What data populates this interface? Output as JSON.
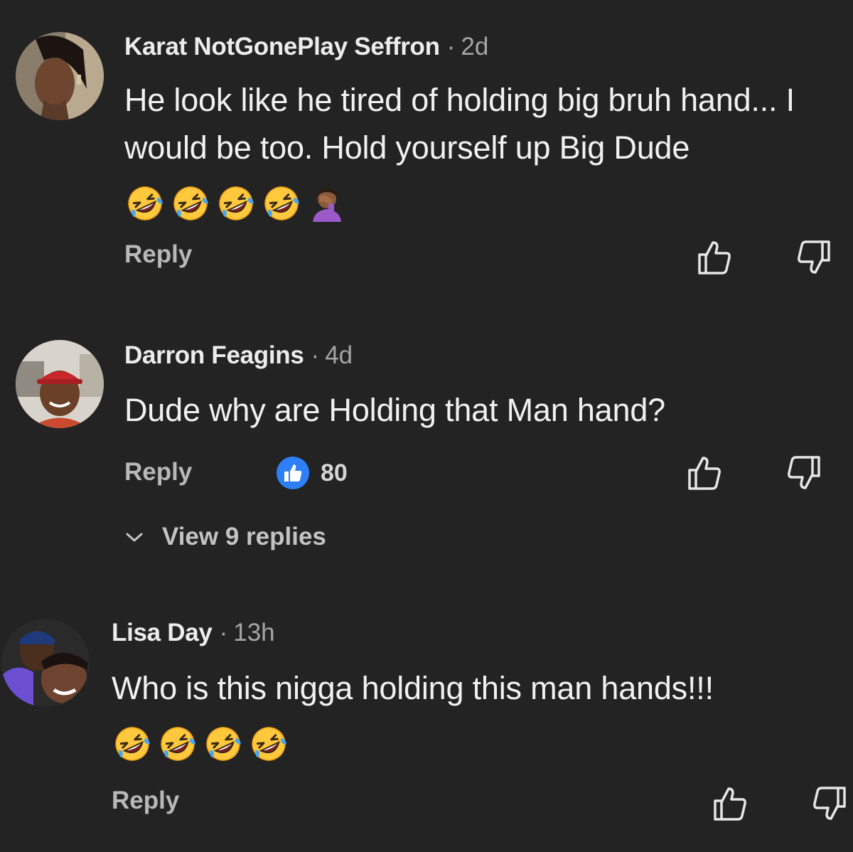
{
  "colors": {
    "background": "#232323",
    "text_primary": "#f1f1f1",
    "text_secondary": "#a5a5a5",
    "like_badge": "#2e7ff7"
  },
  "comments": [
    {
      "author": "Karat NotGonePlay Seffron",
      "separator": "·",
      "age": "2d",
      "text": "He look like he tired of holding big bruh hand... I would be too. Hold yourself up Big Dude",
      "emojis": [
        "rolling-on-floor-laughing-emoji",
        "rolling-on-floor-laughing-emoji",
        "rolling-on-floor-laughing-emoji",
        "rolling-on-floor-laughing-emoji",
        "woman-facepalming-emoji"
      ],
      "reply_label": "Reply",
      "thumbs_up_icon": "thumbs-up-outline-icon",
      "thumbs_down_icon": "thumbs-down-outline-icon"
    },
    {
      "author": "Darron Feagins",
      "separator": "·",
      "age": "4d",
      "text": "Dude why are Holding that Man hand?",
      "reply_label": "Reply",
      "reaction_icon": "like-badge-icon",
      "reaction_count": "80",
      "view_replies_label": "View 9 replies",
      "thumbs_up_icon": "thumbs-up-outline-icon",
      "thumbs_down_icon": "thumbs-down-outline-icon"
    },
    {
      "author": "Lisa Day",
      "separator": "·",
      "age": "13h",
      "text": "Who is this nigga holding this man hands!!!",
      "emojis": [
        "rolling-on-floor-laughing-emoji",
        "rolling-on-floor-laughing-emoji",
        "rolling-on-floor-laughing-emoji",
        "rolling-on-floor-laughing-emoji"
      ],
      "reply_label": "Reply",
      "thumbs_up_icon": "thumbs-up-outline-icon",
      "thumbs_down_icon": "thumbs-down-outline-icon"
    }
  ]
}
